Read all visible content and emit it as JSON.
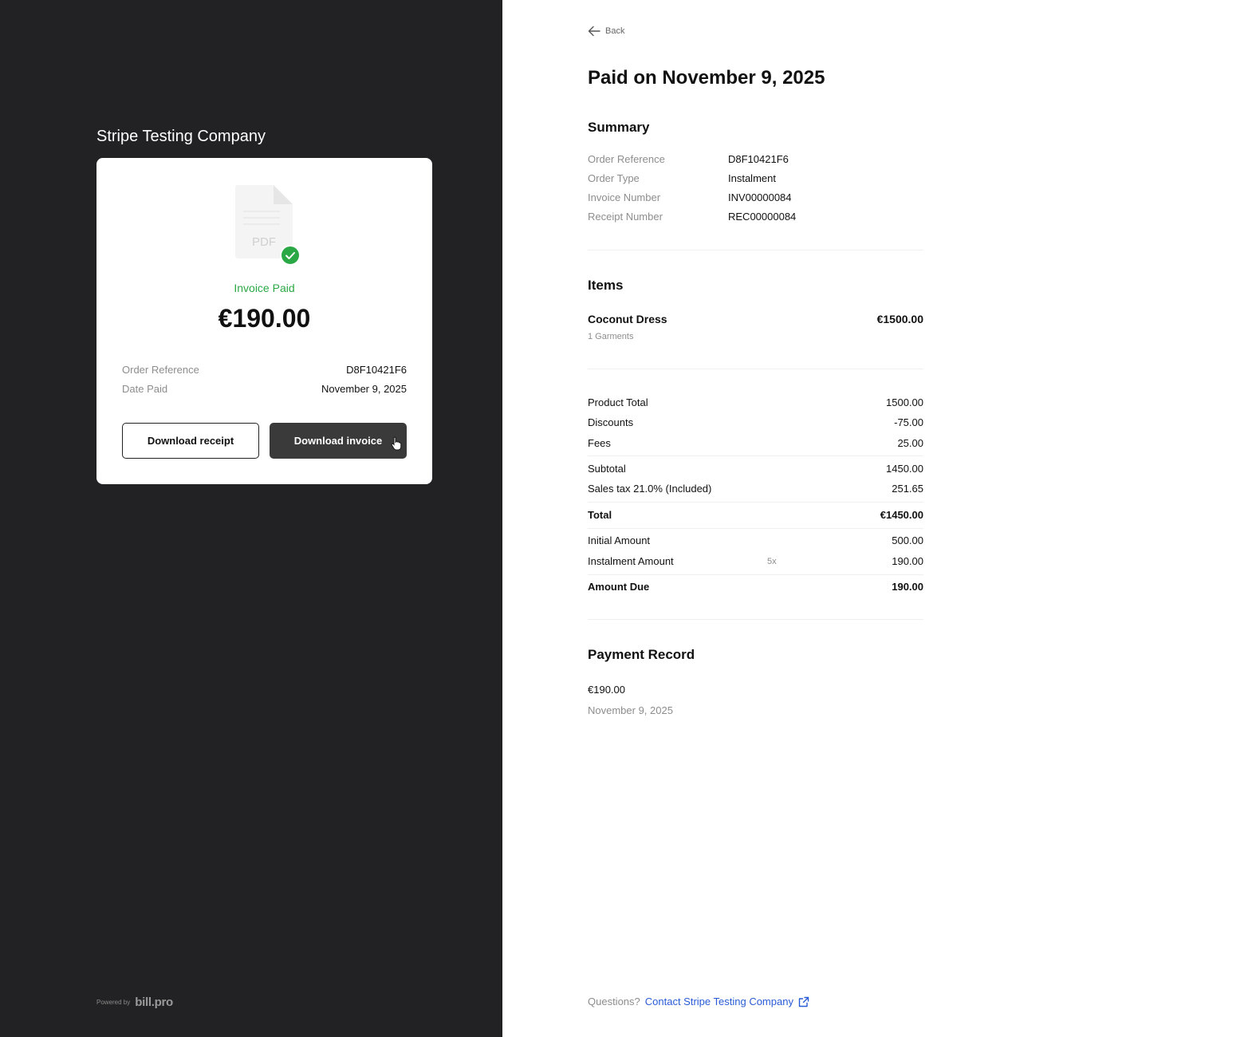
{
  "company": {
    "name": "Stripe Testing Company"
  },
  "card": {
    "pdf_label": "PDF",
    "status": "Invoice Paid",
    "amount": "€190.00",
    "rows": [
      {
        "label": "Order Reference",
        "value": "D8F10421F6"
      },
      {
        "label": "Date Paid",
        "value": "November 9, 2025"
      }
    ],
    "buttons": {
      "receipt": "Download receipt",
      "invoice": "Download invoice"
    }
  },
  "footer_left": {
    "powered_by": "Powered by",
    "brand": "bill.pro"
  },
  "main": {
    "back": "Back",
    "title": "Paid on November 9, 2025",
    "summary": {
      "heading": "Summary",
      "rows": [
        {
          "label": "Order Reference",
          "value": "D8F10421F6"
        },
        {
          "label": "Order Type",
          "value": "Instalment"
        },
        {
          "label": "Invoice Number",
          "value": "INV00000084"
        },
        {
          "label": "Receipt Number",
          "value": "REC00000084"
        }
      ]
    },
    "items": {
      "heading": "Items",
      "list": [
        {
          "name": "Coconut Dress",
          "price": "€1500.00",
          "sub": "1 Garments"
        }
      ]
    },
    "totals": {
      "product_total": {
        "label": "Product Total",
        "value": "1500.00"
      },
      "discounts": {
        "label": "Discounts",
        "value": "-75.00"
      },
      "fees": {
        "label": "Fees",
        "value": "25.00"
      },
      "subtotal": {
        "label": "Subtotal",
        "value": "1450.00"
      },
      "sales_tax": {
        "label": "Sales tax 21.0% (Included)",
        "value": "251.65"
      },
      "total": {
        "label": "Total",
        "value": "€1450.00"
      },
      "initial_amount": {
        "label": "Initial Amount",
        "value": "500.00"
      },
      "instalment_amount": {
        "label": "Instalment Amount",
        "multiplier": "5x",
        "value": "190.00"
      },
      "amount_due": {
        "label": "Amount Due",
        "value": "190.00"
      }
    },
    "payment_record": {
      "heading": "Payment Record",
      "amount": "€190.00",
      "date": "November 9, 2025"
    },
    "footer": {
      "question": "Questions?",
      "contact": "Contact Stripe Testing Company"
    }
  },
  "colors": {
    "sidebar_bg": "#222224",
    "success": "#2aa845",
    "link": "#2a5bd7",
    "button_dark": "#3a3a3a"
  },
  "icons": [
    "file-pdf-icon",
    "check-icon",
    "pointer-cursor-icon",
    "arrow-left-icon",
    "external-link-icon"
  ]
}
